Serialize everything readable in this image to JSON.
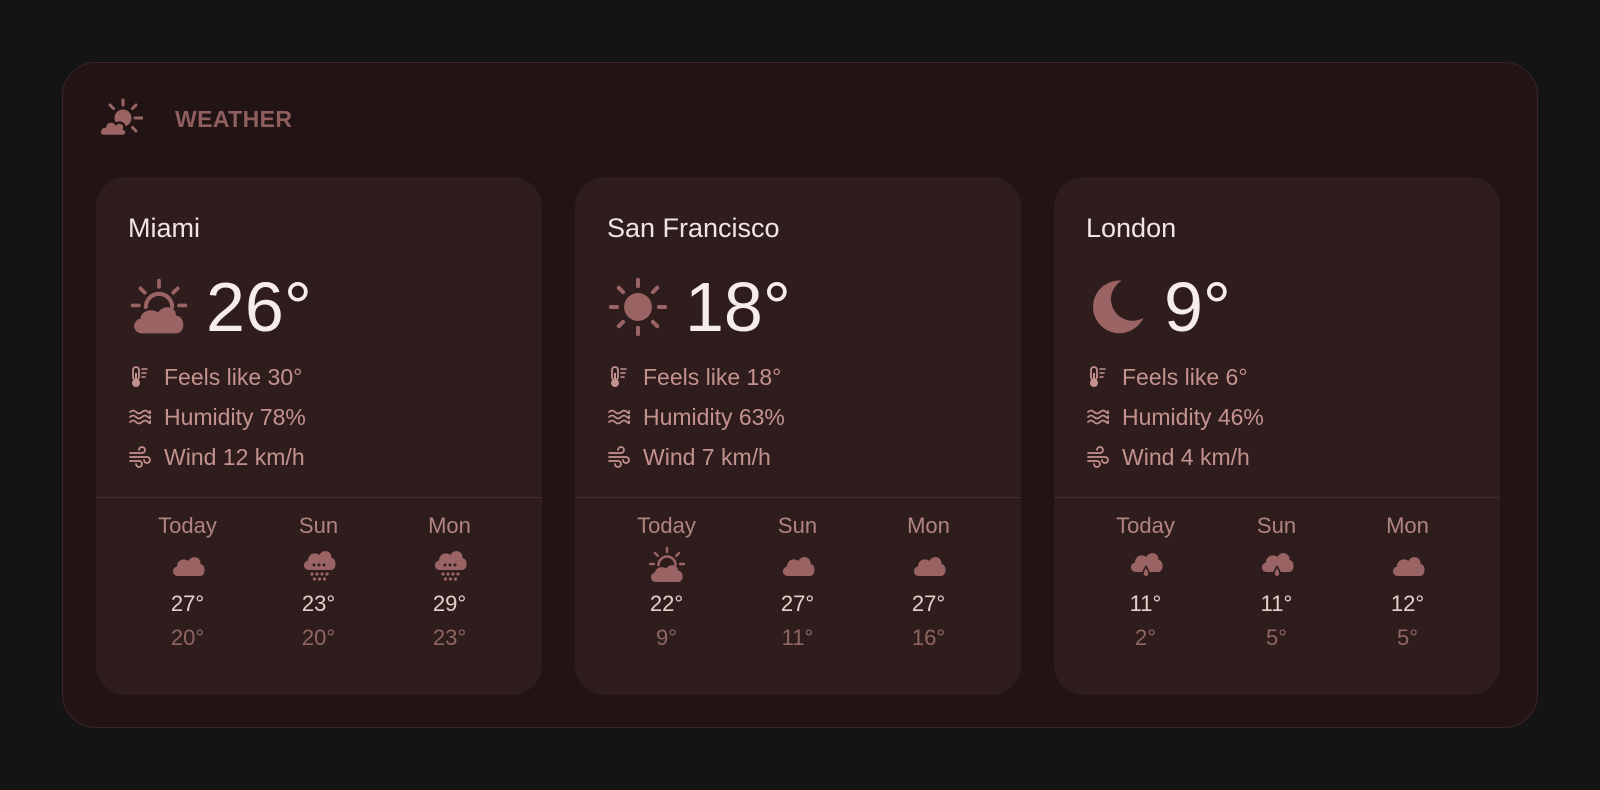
{
  "widget": {
    "title": "WEATHER",
    "icon": "sun-cloud-icon"
  },
  "colors": {
    "background": "#141414",
    "widget_bg": "#221414",
    "card_bg": "#2f1d1d",
    "icon": "#9a6464",
    "text_primary": "#f1e4e2",
    "text_secondary": "#c4928e",
    "text_muted": "#8f6662"
  },
  "cities": [
    {
      "name": "Miami",
      "current_icon": "partly-cloudy-day-icon",
      "temp": "26°",
      "feels_like": "Feels like 30°",
      "humidity": "Humidity 78%",
      "wind": "Wind 12 km/h",
      "forecast": [
        {
          "day": "Today",
          "icon": "cloud-icon",
          "high": "27°",
          "low": "20°"
        },
        {
          "day": "Sun",
          "icon": "cloud-rain-icon",
          "high": "23°",
          "low": "20°"
        },
        {
          "day": "Mon",
          "icon": "cloud-rain-icon",
          "high": "29°",
          "low": "23°"
        }
      ]
    },
    {
      "name": "San Francisco",
      "current_icon": "sun-icon",
      "temp": "18°",
      "feels_like": "Feels like 18°",
      "humidity": "Humidity 63%",
      "wind": "Wind 7 km/h",
      "forecast": [
        {
          "day": "Today",
          "icon": "partly-cloudy-day-icon",
          "high": "22°",
          "low": "9°"
        },
        {
          "day": "Sun",
          "icon": "cloud-icon",
          "high": "27°",
          "low": "11°"
        },
        {
          "day": "Mon",
          "icon": "cloud-icon",
          "high": "27°",
          "low": "16°"
        }
      ]
    },
    {
      "name": "London",
      "current_icon": "moon-icon",
      "temp": "9°",
      "feels_like": "Feels like 6°",
      "humidity": "Humidity 46%",
      "wind": "Wind 4 km/h",
      "forecast": [
        {
          "day": "Today",
          "icon": "cloud-drizzle-icon",
          "high": "11°",
          "low": "2°"
        },
        {
          "day": "Sun",
          "icon": "cloud-drizzle-icon",
          "high": "11°",
          "low": "5°"
        },
        {
          "day": "Mon",
          "icon": "cloud-icon",
          "high": "12°",
          "low": "5°"
        }
      ]
    }
  ]
}
